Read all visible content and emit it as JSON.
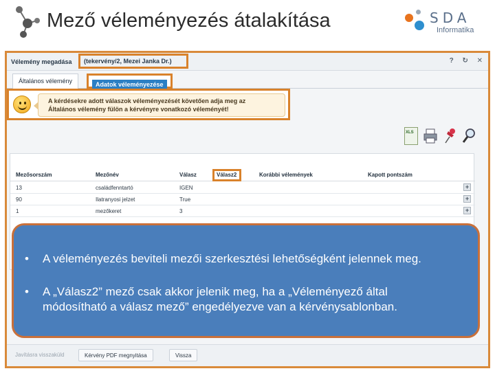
{
  "slide": {
    "title": "Mező véleményezés átalakítása",
    "brand_letters": "SDA",
    "brand_sub": "Informatika"
  },
  "window": {
    "title_prefix": "Vélemény megadása",
    "title_record": "(tekervény/2, Mezei Janka Dr.)",
    "controls": "? ↻ ✕"
  },
  "tabs": [
    {
      "label": "Általános vélemény"
    },
    {
      "label": "Adatok véleményezése"
    }
  ],
  "notice": {
    "line1": "A kérdésekre adott válaszok véleményezését követően adja meg az",
    "line2": "Általános vélemény fülön a kérvényre vonatkozó véleményét!"
  },
  "toolbar_icons": [
    "excel-export-icon",
    "print-icon",
    "pin-icon",
    "search-icon"
  ],
  "grid": {
    "columns": [
      "Mezősorszám",
      "Mezőnév",
      "Válasz",
      "Válasz2",
      "Korábbi vélemények",
      "Kapott pontszám"
    ],
    "rows": [
      [
        "13",
        "családfenntartó",
        "IGEN",
        "",
        "",
        ""
      ],
      [
        "90",
        "Ilatranyosi jelzet",
        "True",
        "",
        "",
        ""
      ],
      [
        "1",
        "mezőkeret",
        "3",
        "",
        "",
        ""
      ]
    ],
    "expand_label": "+"
  },
  "bottom_buttons": [
    {
      "label": "Javításra visszaküld"
    },
    {
      "label": "Kérvény PDF megnyitása"
    },
    {
      "label": "Vissza"
    }
  ],
  "callout": {
    "bullet_glyph": "•",
    "bullet1": "A véleményezés beviteli mezői szerkesztési lehetőségként jelennek meg.",
    "bullet2_line1": "A „Válasz2” mező csak akkor jelenik meg, ha a „Véleményező által",
    "bullet2_line2": "módosítható a válasz mező” engedélyezve van a kérvénysablonban."
  },
  "colors": {
    "highlight": "#d9822b",
    "callout_bg": "#4a7ebb",
    "active_tab": "#2b7fc4"
  }
}
